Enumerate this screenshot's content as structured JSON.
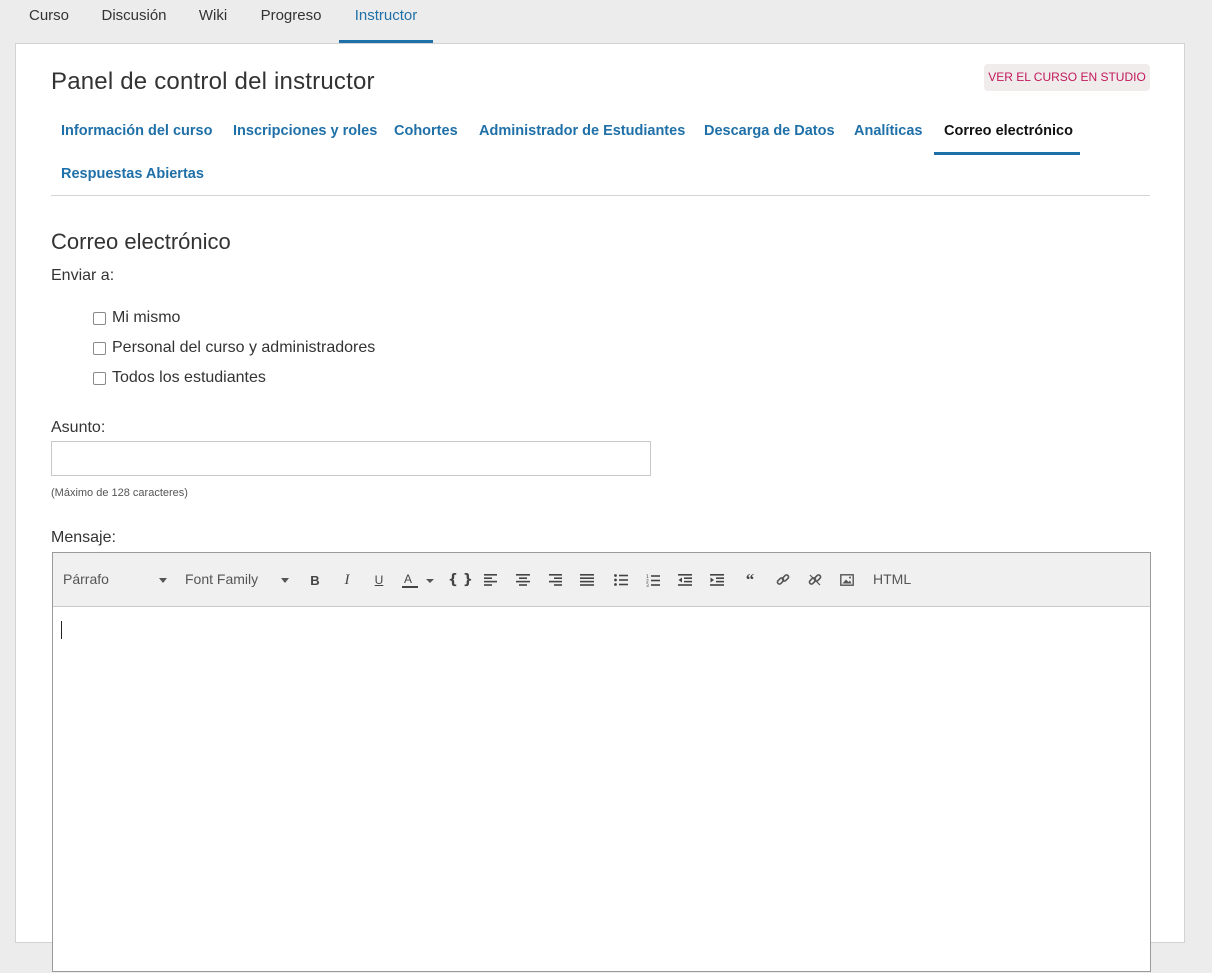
{
  "course_nav": {
    "tabs": [
      "Curso",
      "Discusión",
      "Wiki",
      "Progreso",
      "Instructor"
    ],
    "active": "Instructor"
  },
  "header": {
    "title": "Panel de control del instructor",
    "studio_button": "VER EL CURSO EN STUDIO"
  },
  "section_tabs": {
    "items": [
      "Información del curso",
      "Inscripciones y roles",
      "Cohortes",
      "Administrador de Estudiantes",
      "Descarga de Datos",
      "Analíticas",
      "Correo electrónico",
      "Respuestas Abiertas"
    ],
    "active": "Correo electrónico"
  },
  "email": {
    "heading": "Correo electrónico",
    "send_to_label": "Enviar a:",
    "recipients": [
      "Mi mismo",
      "Personal del curso y administradores",
      "Todos los estudiantes"
    ],
    "subject_label": "Asunto:",
    "subject_value": "",
    "subject_hint": "(Máximo de 128 caracteres)",
    "message_label": "Mensaje:"
  },
  "editor": {
    "format_select": "Párrafo",
    "font_select": "Font Family",
    "html_button": "HTML",
    "icons": [
      "bold-icon",
      "italic-icon",
      "underline-icon",
      "text-color-icon",
      "code-icon",
      "align-left-icon",
      "align-center-icon",
      "align-right-icon",
      "align-justify-icon",
      "bullet-list-icon",
      "numbered-list-icon",
      "outdent-icon",
      "indent-icon",
      "blockquote-icon",
      "link-icon",
      "unlink-icon",
      "image-icon"
    ]
  },
  "colors": {
    "accent": "#1f70a8",
    "studio_text": "#c2185b"
  }
}
